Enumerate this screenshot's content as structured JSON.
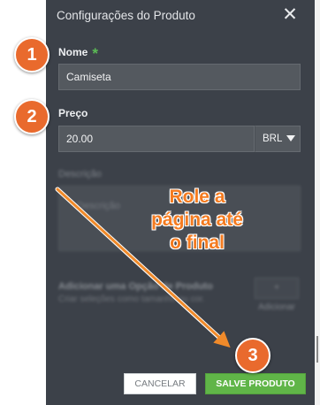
{
  "panel": {
    "title": "Configurações do Produto",
    "close_icon": "close-icon"
  },
  "name_field": {
    "label": "Nome",
    "required_marker": "*",
    "value": "Camiseta"
  },
  "price_field": {
    "label": "Preço",
    "value": "20.00",
    "currency": "BRL"
  },
  "description_field": {
    "label": "Descrição",
    "placeholder": "Descrição"
  },
  "product_options": {
    "label": "Adicionar uma Opção de Produto",
    "hint": "Criar seleções como tamanho ou cor.",
    "button_label": "+ Adicionar"
  },
  "footer": {
    "cancel_label": "CANCELAR",
    "save_label": "SALVE PRODUTO"
  },
  "annotations": {
    "badge_1": "1",
    "badge_2": "2",
    "badge_3": "3",
    "instruction_line_1": "Role a",
    "instruction_line_2": "página até",
    "instruction_line_3": "o final"
  },
  "colors": {
    "panel_bg": "#3c4149",
    "accent_green": "#60b548",
    "annotation_orange": "#e96a2d"
  }
}
